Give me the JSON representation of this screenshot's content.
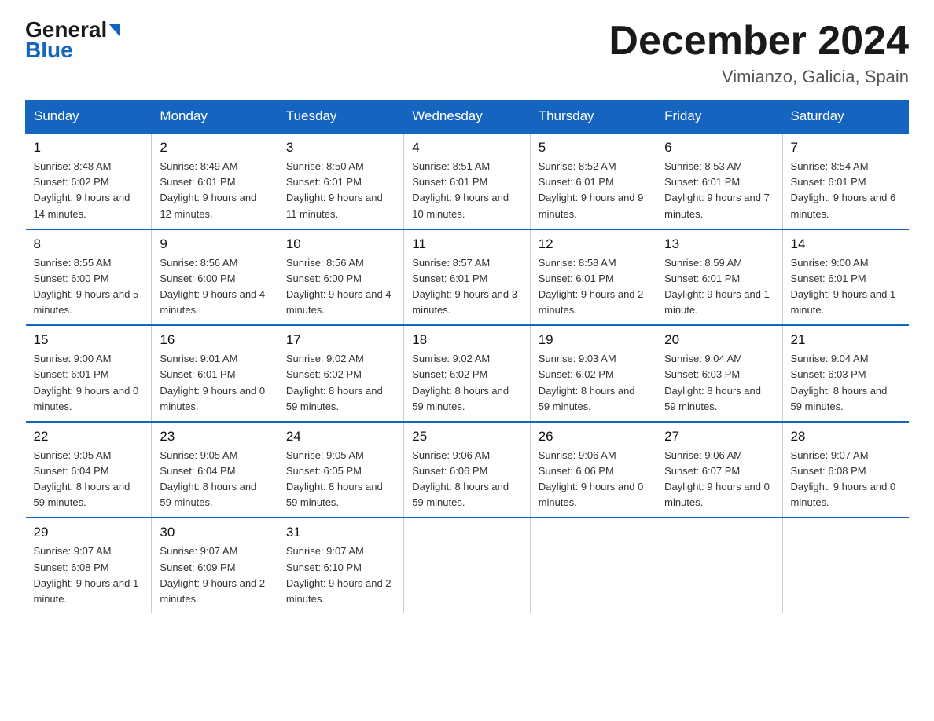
{
  "header": {
    "logo_line1": "General",
    "logo_line2": "Blue",
    "title": "December 2024",
    "subtitle": "Vimianzo, Galicia, Spain"
  },
  "days_of_week": [
    "Sunday",
    "Monday",
    "Tuesday",
    "Wednesday",
    "Thursday",
    "Friday",
    "Saturday"
  ],
  "weeks": [
    [
      {
        "day": "1",
        "sunrise": "8:48 AM",
        "sunset": "6:02 PM",
        "daylight": "9 hours and 14 minutes."
      },
      {
        "day": "2",
        "sunrise": "8:49 AM",
        "sunset": "6:01 PM",
        "daylight": "9 hours and 12 minutes."
      },
      {
        "day": "3",
        "sunrise": "8:50 AM",
        "sunset": "6:01 PM",
        "daylight": "9 hours and 11 minutes."
      },
      {
        "day": "4",
        "sunrise": "8:51 AM",
        "sunset": "6:01 PM",
        "daylight": "9 hours and 10 minutes."
      },
      {
        "day": "5",
        "sunrise": "8:52 AM",
        "sunset": "6:01 PM",
        "daylight": "9 hours and 9 minutes."
      },
      {
        "day": "6",
        "sunrise": "8:53 AM",
        "sunset": "6:01 PM",
        "daylight": "9 hours and 7 minutes."
      },
      {
        "day": "7",
        "sunrise": "8:54 AM",
        "sunset": "6:01 PM",
        "daylight": "9 hours and 6 minutes."
      }
    ],
    [
      {
        "day": "8",
        "sunrise": "8:55 AM",
        "sunset": "6:00 PM",
        "daylight": "9 hours and 5 minutes."
      },
      {
        "day": "9",
        "sunrise": "8:56 AM",
        "sunset": "6:00 PM",
        "daylight": "9 hours and 4 minutes."
      },
      {
        "day": "10",
        "sunrise": "8:56 AM",
        "sunset": "6:00 PM",
        "daylight": "9 hours and 4 minutes."
      },
      {
        "day": "11",
        "sunrise": "8:57 AM",
        "sunset": "6:01 PM",
        "daylight": "9 hours and 3 minutes."
      },
      {
        "day": "12",
        "sunrise": "8:58 AM",
        "sunset": "6:01 PM",
        "daylight": "9 hours and 2 minutes."
      },
      {
        "day": "13",
        "sunrise": "8:59 AM",
        "sunset": "6:01 PM",
        "daylight": "9 hours and 1 minute."
      },
      {
        "day": "14",
        "sunrise": "9:00 AM",
        "sunset": "6:01 PM",
        "daylight": "9 hours and 1 minute."
      }
    ],
    [
      {
        "day": "15",
        "sunrise": "9:00 AM",
        "sunset": "6:01 PM",
        "daylight": "9 hours and 0 minutes."
      },
      {
        "day": "16",
        "sunrise": "9:01 AM",
        "sunset": "6:01 PM",
        "daylight": "9 hours and 0 minutes."
      },
      {
        "day": "17",
        "sunrise": "9:02 AM",
        "sunset": "6:02 PM",
        "daylight": "8 hours and 59 minutes."
      },
      {
        "day": "18",
        "sunrise": "9:02 AM",
        "sunset": "6:02 PM",
        "daylight": "8 hours and 59 minutes."
      },
      {
        "day": "19",
        "sunrise": "9:03 AM",
        "sunset": "6:02 PM",
        "daylight": "8 hours and 59 minutes."
      },
      {
        "day": "20",
        "sunrise": "9:04 AM",
        "sunset": "6:03 PM",
        "daylight": "8 hours and 59 minutes."
      },
      {
        "day": "21",
        "sunrise": "9:04 AM",
        "sunset": "6:03 PM",
        "daylight": "8 hours and 59 minutes."
      }
    ],
    [
      {
        "day": "22",
        "sunrise": "9:05 AM",
        "sunset": "6:04 PM",
        "daylight": "8 hours and 59 minutes."
      },
      {
        "day": "23",
        "sunrise": "9:05 AM",
        "sunset": "6:04 PM",
        "daylight": "8 hours and 59 minutes."
      },
      {
        "day": "24",
        "sunrise": "9:05 AM",
        "sunset": "6:05 PM",
        "daylight": "8 hours and 59 minutes."
      },
      {
        "day": "25",
        "sunrise": "9:06 AM",
        "sunset": "6:06 PM",
        "daylight": "8 hours and 59 minutes."
      },
      {
        "day": "26",
        "sunrise": "9:06 AM",
        "sunset": "6:06 PM",
        "daylight": "9 hours and 0 minutes."
      },
      {
        "day": "27",
        "sunrise": "9:06 AM",
        "sunset": "6:07 PM",
        "daylight": "9 hours and 0 minutes."
      },
      {
        "day": "28",
        "sunrise": "9:07 AM",
        "sunset": "6:08 PM",
        "daylight": "9 hours and 0 minutes."
      }
    ],
    [
      {
        "day": "29",
        "sunrise": "9:07 AM",
        "sunset": "6:08 PM",
        "daylight": "9 hours and 1 minute."
      },
      {
        "day": "30",
        "sunrise": "9:07 AM",
        "sunset": "6:09 PM",
        "daylight": "9 hours and 2 minutes."
      },
      {
        "day": "31",
        "sunrise": "9:07 AM",
        "sunset": "6:10 PM",
        "daylight": "9 hours and 2 minutes."
      },
      null,
      null,
      null,
      null
    ]
  ]
}
